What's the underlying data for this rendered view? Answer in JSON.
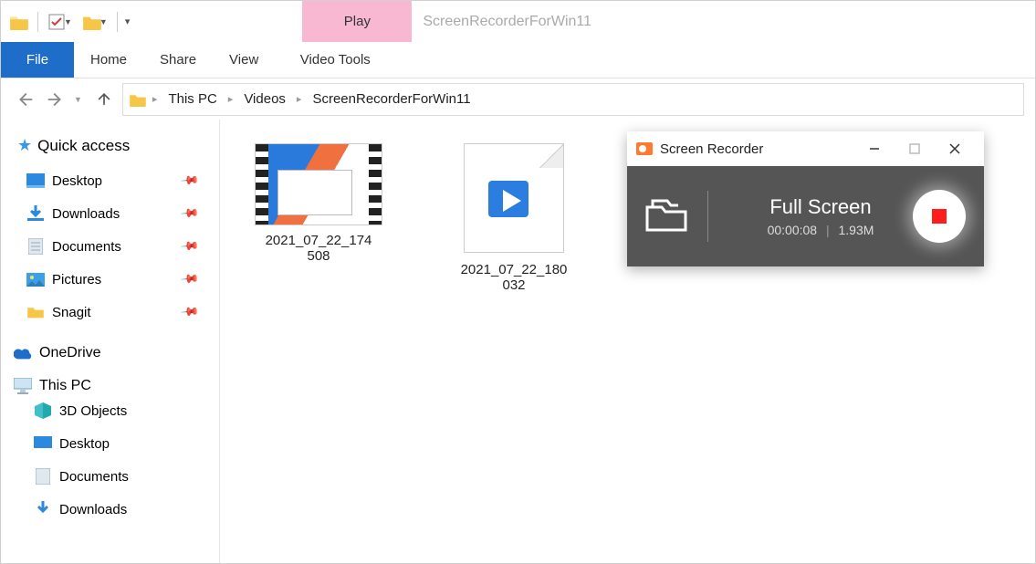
{
  "window": {
    "title": "ScreenRecorderForWin11"
  },
  "play_tab": "Play",
  "ribbon": {
    "file": "File",
    "home": "Home",
    "share": "Share",
    "view": "View",
    "video_tools": "Video Tools"
  },
  "breadcrumb": {
    "root": "This PC",
    "mid": "Videos",
    "leaf": "ScreenRecorderForWin11"
  },
  "sidebar": {
    "quick_access": "Quick access",
    "pinned": [
      {
        "label": "Desktop",
        "icon": "desktop"
      },
      {
        "label": "Downloads",
        "icon": "download"
      },
      {
        "label": "Documents",
        "icon": "document"
      },
      {
        "label": "Pictures",
        "icon": "pictures"
      },
      {
        "label": "Snagit",
        "icon": "folder"
      }
    ],
    "onedrive": "OneDrive",
    "this_pc": "This PC",
    "this_pc_items": [
      {
        "label": "3D Objects",
        "icon": "cube"
      },
      {
        "label": "Desktop",
        "icon": "desktop"
      },
      {
        "label": "Documents",
        "icon": "document"
      },
      {
        "label": "Downloads",
        "icon": "download"
      }
    ]
  },
  "files": [
    {
      "name_l1": "2021_07_22_174",
      "name_l2": "508",
      "kind": "video-thumb"
    },
    {
      "name_l1": "2021_07_22_180",
      "name_l2": "032",
      "kind": "video-generic"
    }
  ],
  "recorder": {
    "title": "Screen Recorder",
    "mode": "Full Screen",
    "elapsed": "00:00:08",
    "size": "1.93M"
  }
}
